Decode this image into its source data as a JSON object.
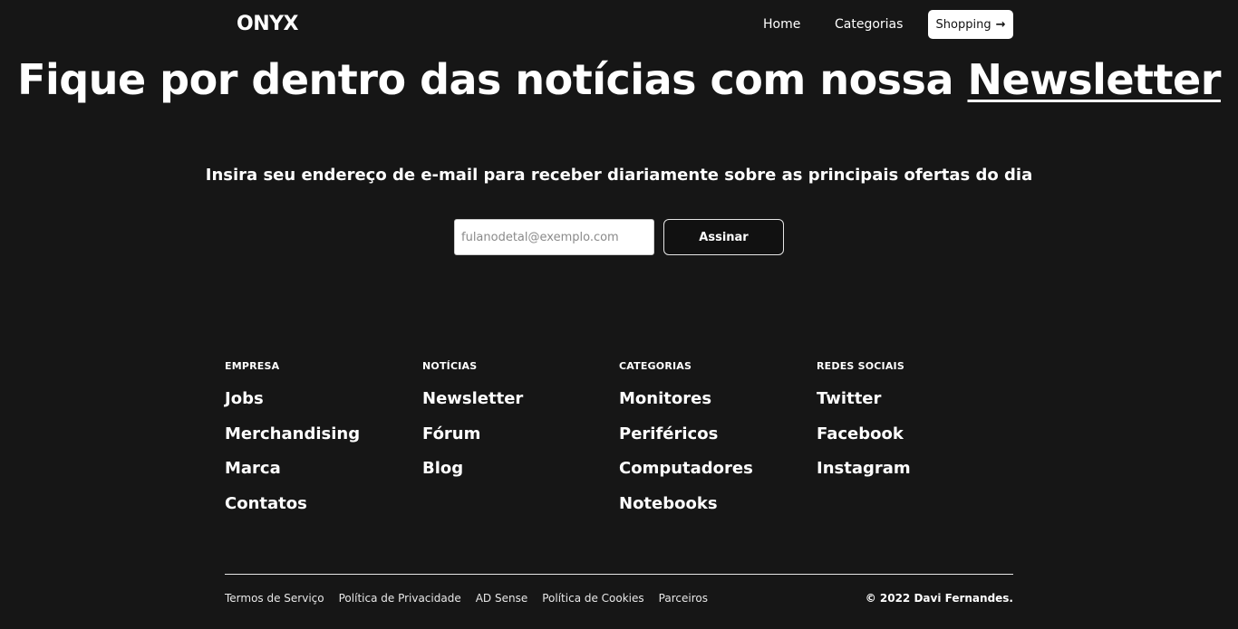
{
  "header": {
    "logo": "ONYX",
    "nav": {
      "home": "Home",
      "categorias": "Categorias"
    },
    "shopping_label": "Shopping",
    "shopping_icon": "arrow-right-icon"
  },
  "hero": {
    "title_part1": "Fique por dentro das notícias com nossa",
    "title_highlight": "Newsletter",
    "subtitle": "Insira seu endereço de e-mail para receber diariamente sobre as principais ofertas do dia",
    "email_placeholder": "fulanodetal@exemplo.com",
    "email_value": "",
    "subscribe_label": "Assinar"
  },
  "footer": {
    "columns": [
      {
        "heading": "EMPRESA",
        "links": [
          "Jobs",
          "Merchandising",
          "Marca",
          "Contatos"
        ]
      },
      {
        "heading": "NOTÍCIAS",
        "links": [
          "Newsletter",
          "Fórum",
          "Blog"
        ]
      },
      {
        "heading": "CATEGORIAS",
        "links": [
          "Monitores",
          "Periféricos",
          "Computadores",
          "Notebooks"
        ]
      },
      {
        "heading": "REDES SOCIAIS",
        "links": [
          "Twitter",
          "Facebook",
          "Instagram"
        ]
      }
    ],
    "bottom_links": [
      "Termos de Serviço",
      "Política de Privacidade",
      "AD Sense",
      "Política de Cookies",
      "Parceiros"
    ],
    "copyright": "© 2022 Davi Fernandes."
  },
  "colors": {
    "background": "#161616",
    "text": "#ffffff",
    "button_light": "#ffffff"
  }
}
